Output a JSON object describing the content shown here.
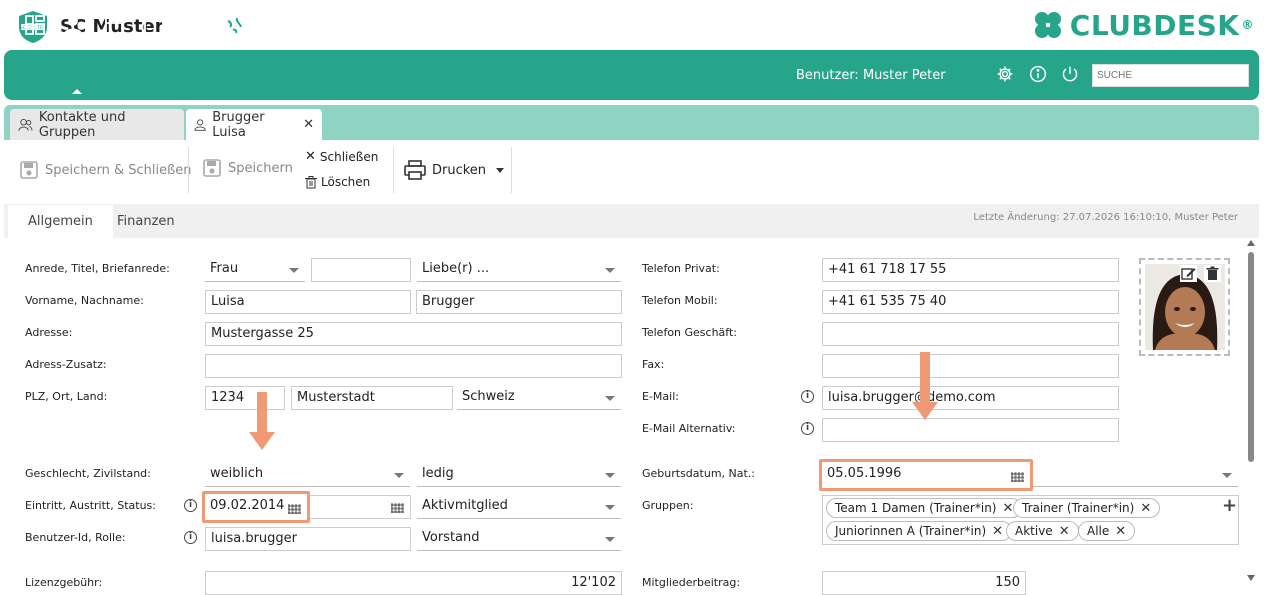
{
  "app": {
    "title": "SC Muster",
    "brand": "CLUBDESK",
    "brand_mark": "®",
    "badge_text": "SC MUSTER",
    "accent": "#27a58a",
    "tab_strip_color": "#8fd3c3",
    "highlight_color": "#ef9a74"
  },
  "navbar": {
    "icons": [
      "dashboard-icon",
      "person-icon",
      "calendar-icon",
      "folder-icon",
      "mail-icon",
      "globe-icon",
      "bank-icon"
    ],
    "user_label": "Benutzer: Muster Peter",
    "search_placeholder": "SUCHE"
  },
  "tabs": [
    {
      "label": "Kontakte und Gruppen",
      "icon": "people-icon"
    },
    {
      "label": "Brugger Luisa",
      "icon": "person-icon",
      "close": "✕"
    }
  ],
  "toolbar": {
    "save_close": "Speichern & Schließen",
    "save": "Speichern",
    "close": "Schließen",
    "delete": "Löschen",
    "print": "Drucken"
  },
  "subtabs": [
    "Allgemein",
    "Finanzen"
  ],
  "last_change": "Letzte Änderung: 27.07.2026 16:10:10, Muster Peter",
  "form_left": {
    "anrede_label": "Anrede, Titel, Briefanrede:",
    "anrede": "Frau",
    "titel": "",
    "briefanrede": "Liebe(r) ...",
    "name_label": "Vorname, Nachname:",
    "vorname": "Luisa",
    "nachname": "Brugger",
    "adresse_label": "Adresse:",
    "adresse": "Mustergasse 25",
    "zusatz_label": "Adress-Zusatz:",
    "zusatz": "",
    "plz_label": "PLZ, Ort, Land:",
    "plz": "1234",
    "ort": "Musterstadt",
    "land": "Schweiz",
    "geschlecht_label": "Geschlecht, Zivilstand:",
    "geschlecht": "weiblich",
    "zivilstand": "ledig",
    "eintritt_label": "Eintritt, Austritt, Status:",
    "eintritt": "09.02.2014",
    "austritt": "",
    "status": "Aktivmitglied",
    "benutzer_label": "Benutzer-Id, Rolle:",
    "benutzer": "luisa.brugger",
    "rolle": "Vorstand",
    "lizenz_label": "Lizenzgebühr:",
    "lizenz": "12'102"
  },
  "form_right": {
    "tel_privat_label": "Telefon Privat:",
    "tel_privat": "+41 61 718 17 55",
    "tel_mobil_label": "Telefon Mobil:",
    "tel_mobil": "+41 61 535 75 40",
    "tel_geschaeft_label": "Telefon Geschäft:",
    "tel_geschaeft": "",
    "fax_label": "Fax:",
    "fax": "",
    "email_label": "E-Mail:",
    "email": "luisa.brugger@demo.com",
    "email_alt_label": "E-Mail Alternativ:",
    "email_alt": "",
    "geburt_label": "Geburtsdatum, Nat.:",
    "geburt": "05.05.1996",
    "nationalitaet": "",
    "gruppen_label": "Gruppen:",
    "gruppen": [
      "Team 1 Damen (Trainer*in)",
      "Trainer (Trainer*in)",
      "Juniorinnen A (Trainer*in)",
      "Aktive",
      "Alle"
    ],
    "mitglied_label": "Mitgliederbeitrag:",
    "mitglied": "150"
  },
  "photo": {
    "edit_icon": "edit-icon",
    "delete_icon": "trash-icon"
  }
}
